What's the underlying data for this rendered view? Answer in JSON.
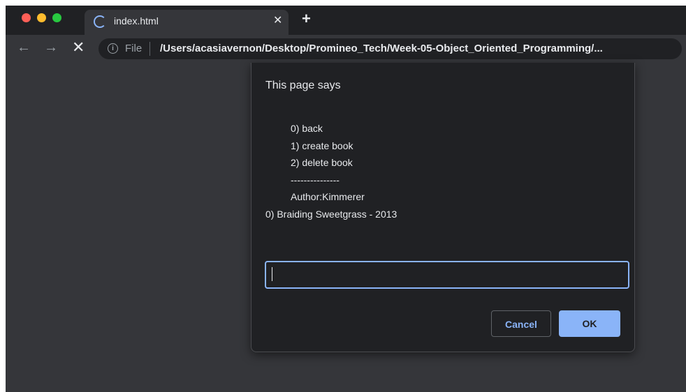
{
  "browser": {
    "tab": {
      "title": "index.html",
      "close_glyph": "✕",
      "loading_icon": "spinner-icon"
    },
    "new_tab_glyph": "+",
    "nav": {
      "back_glyph": "←",
      "forward_glyph": "→",
      "stop_glyph": "✕"
    },
    "address": {
      "info_glyph": "i",
      "scheme": "File",
      "url": "/Users/acasiavernon/Desktop/Promineo_Tech/Week-05-Object_Oriented_Programming/..."
    }
  },
  "dialog": {
    "title": "This page says",
    "message_lines": [
      "0) back",
      "1) create book",
      "2) delete book",
      "---------------",
      "Author:Kimmerer",
      "0) Braiding Sweetgrass - 2013"
    ],
    "input_value": "",
    "cancel_label": "Cancel",
    "ok_label": "OK"
  },
  "colors": {
    "accent": "#8ab4f8",
    "dialog_bg": "#202124",
    "page_bg": "#35363a"
  }
}
